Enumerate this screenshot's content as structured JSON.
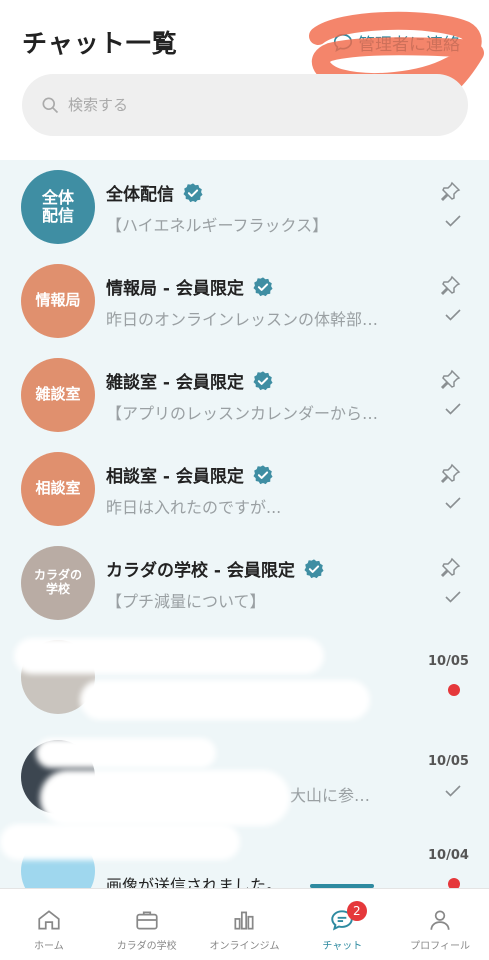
{
  "header": {
    "title": "チャット一覧",
    "contact_label": "管理者に連絡",
    "search_placeholder": "検索する"
  },
  "colors": {
    "accent": "#2e8aa0",
    "avatar_blue": "#3f8ea3",
    "avatar_orange": "#e0906e",
    "avatar_gray": "#b9aca4",
    "unread": "#e5383b"
  },
  "chats": [
    {
      "avatar_text": [
        "全体",
        "配信"
      ],
      "title": "全体配信",
      "subtitle": "【ハイエネルギーフラックス】",
      "verified": true
    },
    {
      "avatar_text": [
        "情報局"
      ],
      "title": "情報局 - 会員限定",
      "subtitle": "昨日のオンラインレッスンの体幹部…",
      "verified": true
    },
    {
      "avatar_text": [
        "雑談室"
      ],
      "title": "雑談室 - 会員限定",
      "subtitle": "【アプリのレッスンカレンダーから…",
      "verified": true
    },
    {
      "avatar_text": [
        "相談室"
      ],
      "title": "相談室 - 会員限定",
      "subtitle": "昨日は入れたのですが...",
      "verified": true
    },
    {
      "avatar_text": [
        "カラダの",
        "学校"
      ],
      "title": "カラダの学校 - 会員限定",
      "subtitle": "【プチ減量について】",
      "verified": true
    }
  ],
  "direct_chats": [
    {
      "date": "10/05",
      "status": "unread"
    },
    {
      "date": "10/05",
      "status": "read",
      "subtitle_fragment": "大山に参…"
    },
    {
      "date": "10/04",
      "status": "unread",
      "subtitle": "画像が送信されました。"
    }
  ],
  "tabs": [
    {
      "label": "ホーム",
      "icon": "home-icon"
    },
    {
      "label": "カラダの学校",
      "icon": "briefcase-icon"
    },
    {
      "label": "オンラインジム",
      "icon": "bar-chart-icon"
    },
    {
      "label": "チャット",
      "icon": "chat-icon",
      "badge": "2"
    },
    {
      "label": "プロフィール",
      "icon": "profile-icon"
    }
  ]
}
